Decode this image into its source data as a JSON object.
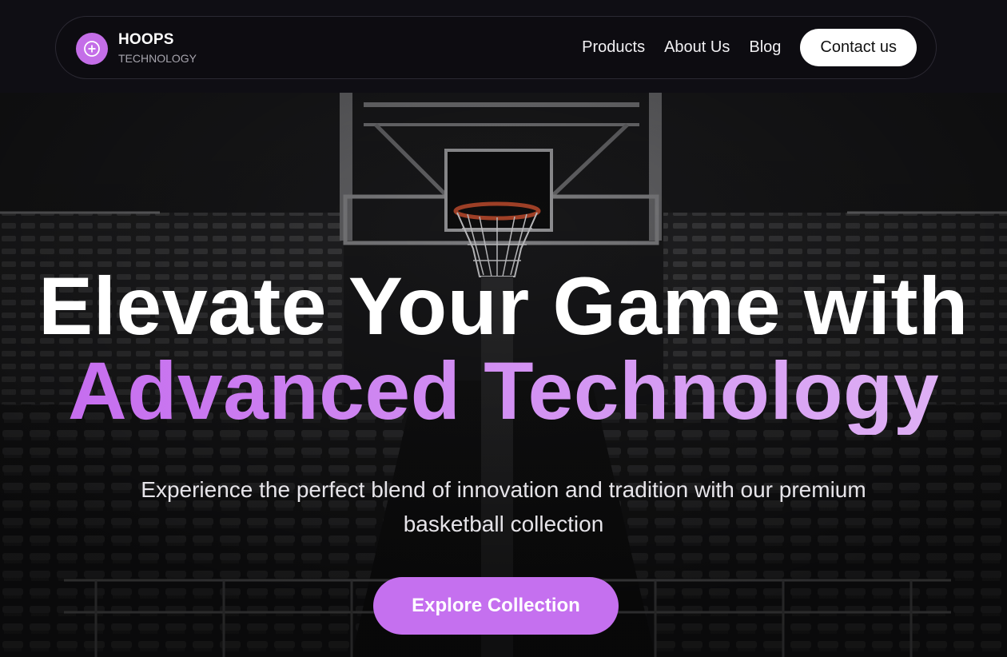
{
  "nav": {
    "brand_name": "HOOPS",
    "brand_sub": "TECHNOLOGY",
    "logo_icon": "plus-circle-icon",
    "links": [
      "Products",
      "About Us",
      "Blog"
    ],
    "contact_label": "Contact us"
  },
  "hero": {
    "headline_line1": "Elevate Your Game with",
    "headline_line2": "Advanced Technology",
    "subtitle": "Experience the perfect blend of innovation and tradition with our premium basketball collection",
    "cta_label": "Explore Collection",
    "background": "basketball-arena-photo"
  },
  "colors": {
    "accent": "#c570ef",
    "nav_bg": "#0d0c11",
    "contact_bg": "#ffffff"
  }
}
